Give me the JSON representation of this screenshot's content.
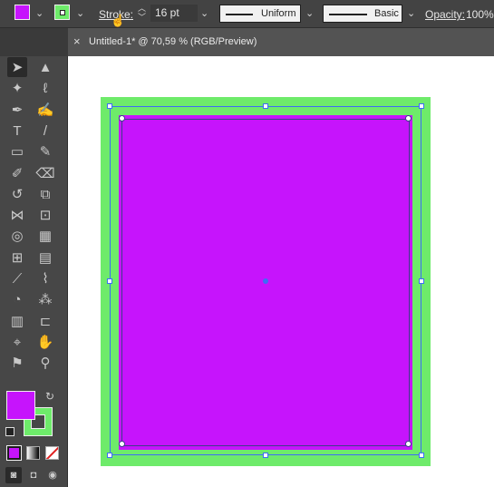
{
  "colors": {
    "fill": "#c614fc",
    "stroke": "#6eeb6a",
    "accent_blue": "#3d6df5"
  },
  "controlbar": {
    "stroke_label": "Stroke:",
    "stroke_weight": "16 pt",
    "profile": "Uniform",
    "brush": "Basic",
    "opacity_label": "Opacity:",
    "opacity_value": "100%"
  },
  "tab": {
    "title": "Untitled-1* @ 70,59 % (RGB/Preview)",
    "close": "×"
  },
  "panel": {
    "collapse": "‹‹"
  },
  "tools": [
    {
      "name": "selection-tool",
      "glyph": "➤"
    },
    {
      "name": "direct-selection-tool",
      "glyph": "▲"
    },
    {
      "name": "magic-wand-tool",
      "glyph": "✦"
    },
    {
      "name": "lasso-tool",
      "glyph": "ℓ"
    },
    {
      "name": "pen-tool",
      "glyph": "✒"
    },
    {
      "name": "curvature-tool",
      "glyph": "✍"
    },
    {
      "name": "type-tool",
      "glyph": "T"
    },
    {
      "name": "line-segment-tool",
      "glyph": "/"
    },
    {
      "name": "rectangle-tool",
      "glyph": "▭"
    },
    {
      "name": "paintbrush-tool",
      "glyph": "✎"
    },
    {
      "name": "shaper-tool",
      "glyph": "✐"
    },
    {
      "name": "eraser-tool",
      "glyph": "⌫"
    },
    {
      "name": "rotate-tool",
      "glyph": "↺"
    },
    {
      "name": "scale-tool",
      "glyph": "⧉"
    },
    {
      "name": "width-tool",
      "glyph": "⋈"
    },
    {
      "name": "free-transform-tool",
      "glyph": "⊡"
    },
    {
      "name": "shape-builder-tool",
      "glyph": "◎"
    },
    {
      "name": "perspective-grid-tool",
      "glyph": "▦"
    },
    {
      "name": "mesh-tool",
      "glyph": "⊞"
    },
    {
      "name": "gradient-tool",
      "glyph": "▤"
    },
    {
      "name": "eyedropper-tool",
      "glyph": "⟋"
    },
    {
      "name": "measure-tool",
      "glyph": "⌇"
    },
    {
      "name": "blend-tool",
      "glyph": "◔"
    },
    {
      "name": "symbol-sprayer-tool",
      "glyph": "⁂"
    },
    {
      "name": "column-graph-tool",
      "glyph": "▥"
    },
    {
      "name": "artboard-tool",
      "glyph": "⊏"
    },
    {
      "name": "slice-tool",
      "glyph": "⌖"
    },
    {
      "name": "hand-tool",
      "glyph": "✋"
    },
    {
      "name": "zoom-tool",
      "glyph": "⚑"
    },
    {
      "name": "magnify-tool",
      "glyph": "⚲"
    }
  ]
}
